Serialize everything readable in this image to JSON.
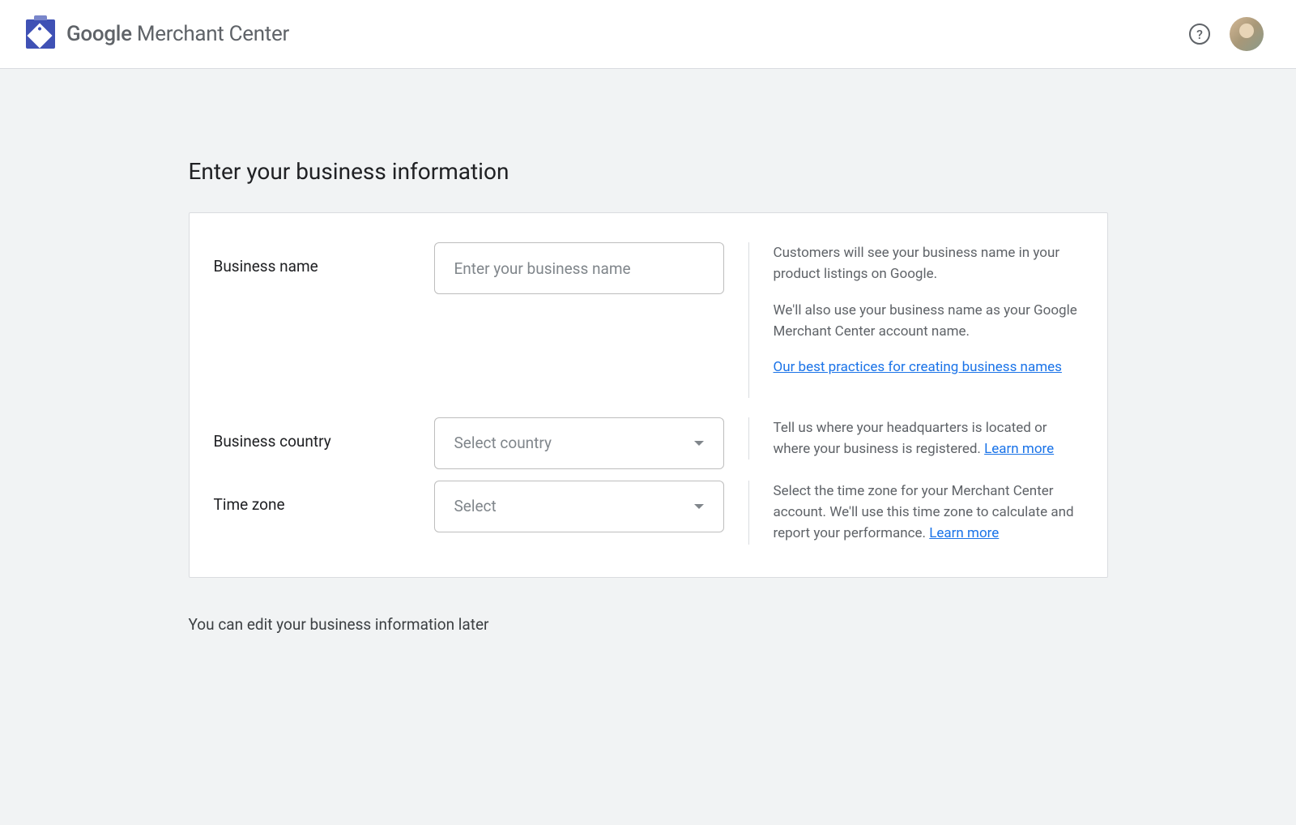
{
  "header": {
    "brand_google": "Google",
    "brand_product": " Merchant Center"
  },
  "page": {
    "title": "Enter your business information",
    "footer_note": "You can edit your business information later"
  },
  "form": {
    "business_name": {
      "label": "Business name",
      "placeholder": "Enter your business name",
      "help_p1": "Customers will see your business name in your product listings on Google.",
      "help_p2": "We'll also use your business name as your Google Merchant Center account name.",
      "help_link": "Our best practices for creating business names"
    },
    "business_country": {
      "label": "Business country",
      "placeholder": "Select country",
      "help_text": "Tell us where your headquarters is located or where your business is registered. ",
      "help_link": "Learn more"
    },
    "time_zone": {
      "label": "Time zone",
      "placeholder": "Select",
      "help_text": "Select the time zone for your Merchant Center account. We'll use this time zone to calculate and report your performance. ",
      "help_link": "Learn more"
    }
  }
}
